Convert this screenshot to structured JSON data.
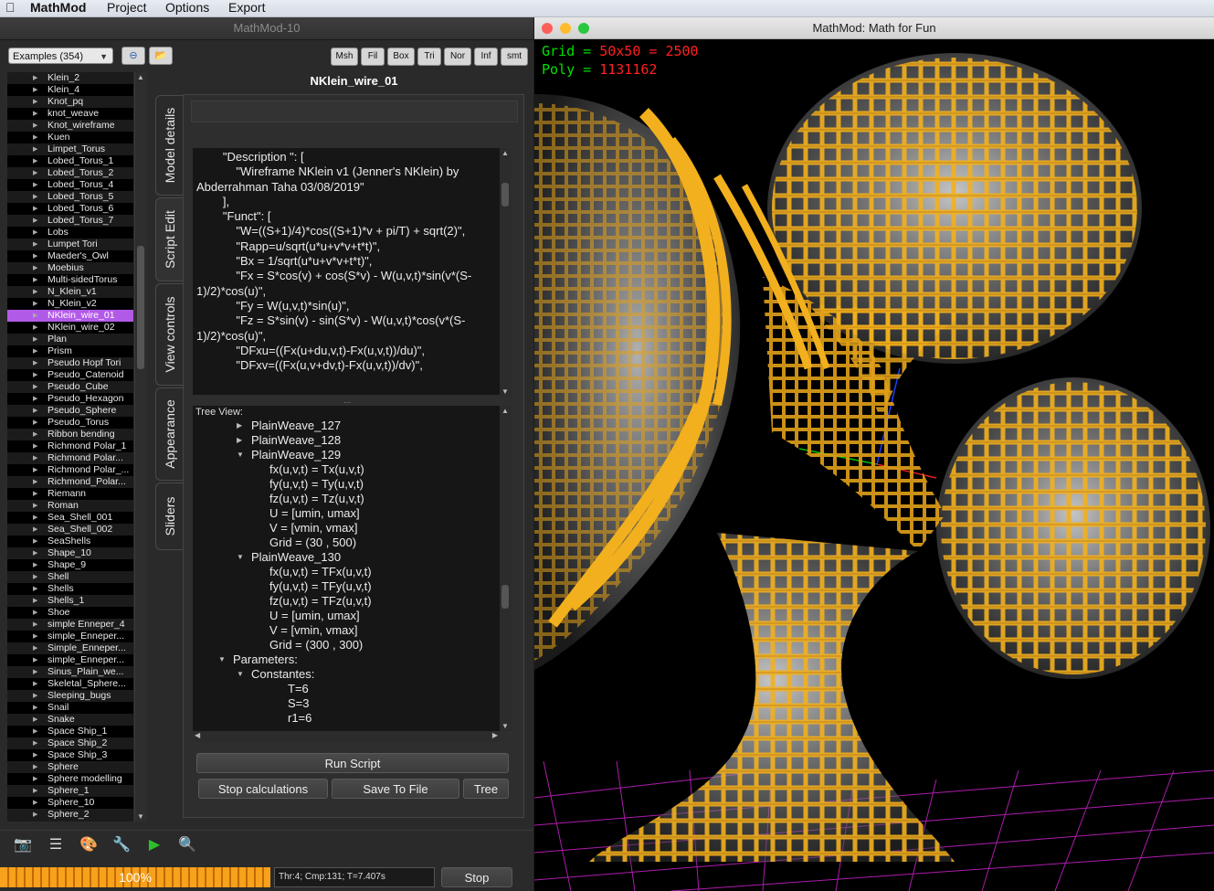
{
  "menubar": {
    "apple": "",
    "items": [
      "MathMod",
      "Project",
      "Options",
      "Export"
    ]
  },
  "left_window": {
    "title": "MathMod-10",
    "examples_select": "Examples (354)",
    "toolbar_buttons": [
      "Msh",
      "Fil",
      "Box",
      "Tri",
      "Nor",
      "Inf",
      "smt"
    ],
    "model_title": "NKlein_wire_01",
    "examples": [
      "Klein_2",
      "Klein_4",
      "Knot_pq",
      "knot_weave",
      "Knot_wireframe",
      "Kuen",
      "Limpet_Torus",
      "Lobed_Torus_1",
      "Lobed_Torus_2",
      "Lobed_Torus_4",
      "Lobed_Torus_5",
      "Lobed_Torus_6",
      "Lobed_Torus_7",
      "Lobs",
      "Lumpet Tori",
      "Maeder's_Owl",
      "Moebius",
      "Multi-sidedTorus",
      "N_Klein_v1",
      "N_Klein_v2",
      "NKlein_wire_01",
      "NKlein_wire_02",
      "Plan",
      "Prism",
      "Pseudo Hopf Tori",
      "Pseudo_Catenoid",
      "Pseudo_Cube",
      "Pseudo_Hexagon",
      "Pseudo_Sphere",
      "Pseudo_Torus",
      "Ribbon bending",
      "Richmond Polar_1",
      "Richmond Polar...",
      "Richmond Polar_...",
      "Richmond_Polar...",
      "Riemann",
      "Roman",
      "Sea_Shell_001",
      "Sea_Shell_002",
      "SeaShells",
      "Shape_10",
      "Shape_9",
      "Shell",
      "Shells",
      "Shells_1",
      "Shoe",
      "simple Enneper_4",
      "simple_Enneper...",
      "Simple_Enneper...",
      "simple_Enneper...",
      "Sinus_Plain_we...",
      "Skeletal_Sphere...",
      "Sleeping_bugs",
      "Snail",
      "Snake",
      "Space Ship_1",
      "Space Ship_2",
      "Space Ship_3",
      "Sphere",
      "Sphere modelling",
      "Sphere_1",
      "Sphere_10",
      "Sphere_2"
    ],
    "selected_index": 20,
    "tabs": [
      "Model details",
      "Script Edit",
      "View controls",
      "Appearance",
      "Sliders"
    ],
    "script_lines": [
      "        \"Description \": [",
      "            \"Wireframe NKlein v1 (Jenner's NKlein) by Abderrahman Taha 03/08/2019\"",
      "        ],",
      "        \"Funct\": [",
      "            \"W=((S+1)/4)*cos((S+1)*v + pi/T) + sqrt(2)\",",
      "            \"Rapp=u/sqrt(u*u+v*v+t*t)\",",
      "            \"Bx = 1/sqrt(u*u+v*v+t*t)\",",
      "            \"Fx = S*cos(v) + cos(S*v) - W(u,v,t)*sin(v*(S-1)/2)*cos(u)\",",
      "            \"Fy = W(u,v,t)*sin(u)\",",
      "            \"Fz = S*sin(v) - sin(S*v) - W(u,v,t)*cos(v*(S-1)/2)*cos(u)\",",
      "            \"DFxu=((Fx(u+du,v,t)-Fx(u,v,t))/du)\",",
      "            \"DFxv=((Fx(u,v+dv,t)-Fx(u,v,t))/dv)\","
    ],
    "tree_label": "Tree View:",
    "tree": [
      {
        "text": "PlainWeave_127",
        "indent": 1,
        "arrow": "right"
      },
      {
        "text": "PlainWeave_128",
        "indent": 1,
        "arrow": "right"
      },
      {
        "text": "PlainWeave_129",
        "indent": 1,
        "arrow": "down"
      },
      {
        "text": "fx(u,v,t) = Tx(u,v,t)",
        "indent": 2,
        "arrow": ""
      },
      {
        "text": "fy(u,v,t) = Ty(u,v,t)",
        "indent": 2,
        "arrow": ""
      },
      {
        "text": "fz(u,v,t) = Tz(u,v,t)",
        "indent": 2,
        "arrow": ""
      },
      {
        "text": "U = [umin, umax]",
        "indent": 2,
        "arrow": ""
      },
      {
        "text": "V = [vmin, vmax]",
        "indent": 2,
        "arrow": ""
      },
      {
        "text": "Grid = (30 , 500)",
        "indent": 2,
        "arrow": ""
      },
      {
        "text": "PlainWeave_130",
        "indent": 1,
        "arrow": "down"
      },
      {
        "text": "fx(u,v,t) = TFx(u,v,t)",
        "indent": 2,
        "arrow": ""
      },
      {
        "text": "fy(u,v,t) = TFy(u,v,t)",
        "indent": 2,
        "arrow": ""
      },
      {
        "text": "fz(u,v,t) = TFz(u,v,t)",
        "indent": 2,
        "arrow": ""
      },
      {
        "text": "U = [umin, umax]",
        "indent": 2,
        "arrow": ""
      },
      {
        "text": "V = [vmin, vmax]",
        "indent": 2,
        "arrow": ""
      },
      {
        "text": "Grid = (300 , 300)",
        "indent": 2,
        "arrow": ""
      },
      {
        "text": "Parameters:",
        "indent": 0,
        "arrow": "down"
      },
      {
        "text": "Constantes:",
        "indent": 1,
        "arrow": "down"
      },
      {
        "text": "T=6",
        "indent": 3,
        "arrow": ""
      },
      {
        "text": "S=3",
        "indent": 3,
        "arrow": ""
      },
      {
        "text": "r1=6",
        "indent": 3,
        "arrow": ""
      }
    ],
    "buttons": {
      "run": "Run Script",
      "stop_calc": "Stop calculations",
      "save": "Save To File",
      "tree": "Tree"
    },
    "progress_percent": 100,
    "progress_label": "100%",
    "status": "Thr:4; Cmp:131; T=7.407s",
    "stop": "Stop"
  },
  "right_window": {
    "title": "MathMod: Math for Fun",
    "hud_grid_label": "Grid = ",
    "hud_grid_value": "50x50 = 2500",
    "hud_poly_label": "Poly = ",
    "hud_poly_value": "1131162",
    "colors": {
      "hud_label": "#00e000",
      "hud_value": "#ff2020",
      "gold": "#f2b01e",
      "grid": "#c020c0"
    }
  }
}
